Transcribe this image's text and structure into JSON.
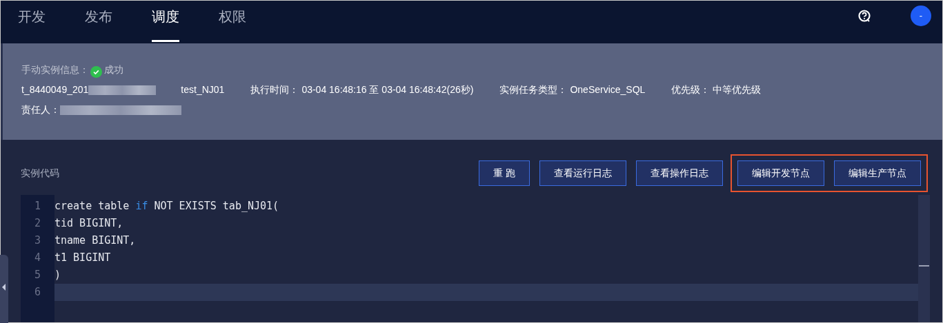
{
  "nav_tabs": [
    {
      "label": "开发",
      "selected": false
    },
    {
      "label": "发布",
      "selected": false
    },
    {
      "label": "调度",
      "selected": true
    },
    {
      "label": "权限",
      "selected": false
    }
  ],
  "avatar": {
    "label": "-"
  },
  "instance_info": {
    "heading": "手动实例信息：",
    "status": "成功",
    "instance_id": "t_8440049_201",
    "node_name": "test_NJ01",
    "fields": [
      {
        "label": "执行时间：",
        "value": "03-04 16:48:16 至 03-04 16:48:42(26秒)"
      },
      {
        "label": "实例任务类型：",
        "value": "OneService_SQL"
      },
      {
        "label": "优先级：",
        "value": "中等优先级"
      }
    ],
    "owner_label": "责任人："
  },
  "code_section": {
    "title": "实例代码"
  },
  "button_groups": [
    {
      "highlighted": false,
      "buttons": [
        "重 跑",
        "查看运行日志",
        "查看操作日志"
      ]
    },
    {
      "highlighted": true,
      "buttons": [
        "编辑开发节点",
        "编辑生产节点"
      ]
    }
  ],
  "code_lines": [
    {
      "number": "1",
      "current": false,
      "tokens": [
        {
          "text": "create table ",
          "kind": "plain"
        },
        {
          "text": "if",
          "kind": "keyword"
        },
        {
          "text": " NOT EXISTS tab_NJ01(",
          "kind": "plain"
        }
      ]
    },
    {
      "number": "2",
      "current": false,
      "tokens": [
        {
          "text": "tid BIGINT,",
          "kind": "plain"
        }
      ]
    },
    {
      "number": "3",
      "current": false,
      "tokens": [
        {
          "text": "tname BIGINT,",
          "kind": "plain"
        }
      ]
    },
    {
      "number": "4",
      "current": false,
      "tokens": [
        {
          "text": "t1 BIGINT",
          "kind": "plain"
        }
      ]
    },
    {
      "number": "5",
      "current": false,
      "tokens": [
        {
          "text": ")",
          "kind": "plain"
        }
      ]
    },
    {
      "number": "6",
      "current": true
    }
  ]
}
